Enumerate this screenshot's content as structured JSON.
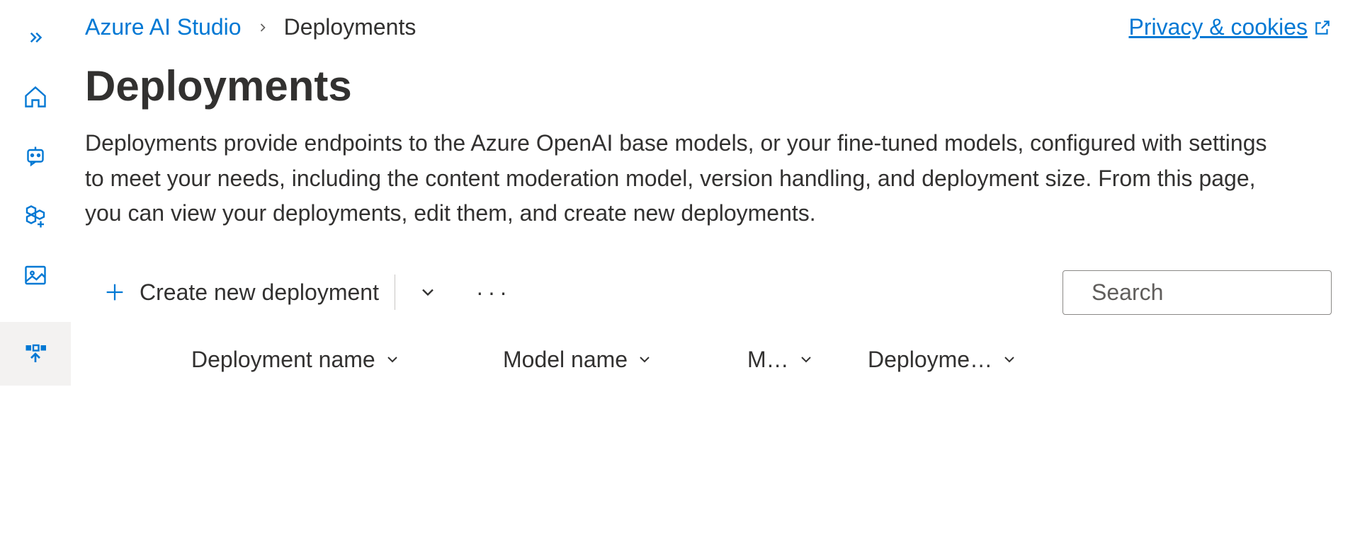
{
  "sidebar": {
    "items": [
      {
        "name": "expand",
        "icon": "chevron-right-double"
      },
      {
        "name": "home",
        "icon": "home"
      },
      {
        "name": "chat",
        "icon": "bot"
      },
      {
        "name": "models",
        "icon": "hexagons-plus"
      },
      {
        "name": "images",
        "icon": "image"
      },
      {
        "name": "deployments",
        "icon": "deploy-arrow",
        "active": true
      }
    ]
  },
  "breadcrumb": {
    "root": "Azure AI Studio",
    "current": "Deployments"
  },
  "privacy": {
    "label": "Privacy & cookies"
  },
  "header": {
    "title": "Deployments",
    "description": "Deployments provide endpoints to the Azure OpenAI base models, or your fine-tuned models, configured with settings to meet your needs, including the content moderation model, version handling, and deployment size. From this page, you can view your deployments, edit them, and create new deployments."
  },
  "toolbar": {
    "create_label": "Create new deployment"
  },
  "search": {
    "placeholder": "Search",
    "value": ""
  },
  "table": {
    "columns": [
      {
        "label": "Deployment name"
      },
      {
        "label": "Model name"
      },
      {
        "label": "M…"
      },
      {
        "label": "Deployme…"
      }
    ]
  }
}
